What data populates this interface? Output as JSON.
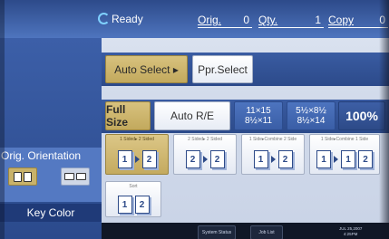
{
  "status": {
    "ready_label": "Ready"
  },
  "counters": {
    "orig_label": "Orig.",
    "orig_value": "0",
    "qty_label": "Qty.",
    "qty_value": "1",
    "copy_label": "Copy",
    "copy_value": "0"
  },
  "paper": {
    "auto_select_label": "Auto Select ▸",
    "ppr_select_label": "Ppr.Select"
  },
  "reduce_enlarge": {
    "full_size_label": "Full Size",
    "auto_re_label": "Auto R/E",
    "preset1_top": "11×15",
    "preset1_bottom": "8½×11",
    "preset2_top": "5½×8½",
    "preset2_bottom": "8½×14",
    "zoom_label": "100%"
  },
  "orig_orientation": {
    "title": "Orig. Orientation"
  },
  "duplex": {
    "option1_caption": "1 Sided▸ 2 Sided",
    "option2_caption": "2 Sided▸ 2 Sided",
    "option3_caption": "1 Side▸Combine 2 Side",
    "option4_caption": "1 Side▸Combine 1 Side",
    "sort_caption": "Sort",
    "page1": "1",
    "page2": "2"
  },
  "key_color_label": "Key Color",
  "bottom": {
    "system_status_label": "System Status",
    "job_list_label": "Job List",
    "date_text": "JUL 25,2007",
    "time_text": "4:25PM"
  },
  "colors": {
    "accent_selected": "#c8b26a",
    "panel_blue": "#3c5fa8",
    "status_bar": "#2d4a8a"
  }
}
